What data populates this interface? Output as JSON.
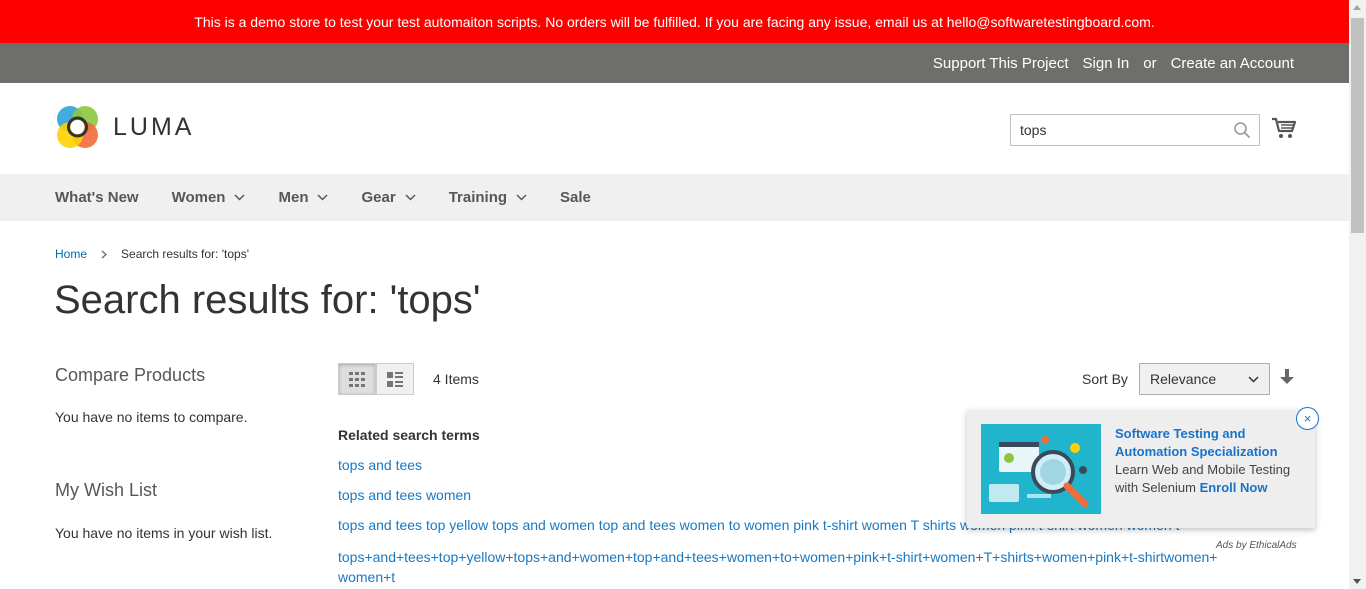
{
  "demo_notice": "This is a demo store to test your test automaiton scripts. No orders will be fulfilled. If you are facing any issue, email us at hello@softwaretestingboard.com.",
  "header": {
    "support": "Support This Project",
    "sign_in": "Sign In",
    "or": "or",
    "create_account": "Create an Account"
  },
  "logo": {
    "text": "LUMA"
  },
  "search": {
    "value": "tops"
  },
  "nav": [
    "What's New",
    "Women",
    "Men",
    "Gear",
    "Training",
    "Sale"
  ],
  "breadcrumb": {
    "home": "Home",
    "current": "Search results for: 'tops'"
  },
  "page_title": "Search results for: 'tops'",
  "sidebar": {
    "compare_title": "Compare Products",
    "compare_text": "You have no items to compare.",
    "wishlist_title": "My Wish List",
    "wishlist_text": "You have no items in your wish list."
  },
  "toolbar": {
    "item_count": "4 Items",
    "sort_label": "Sort By",
    "sort_value": "Relevance"
  },
  "related": {
    "title": "Related search terms",
    "terms": [
      "tops and tees",
      "tops and tees women",
      "tops and tees top yellow tops and women top and tees women to women pink t-shirt women T shirts women pink t-shirt women women t",
      "tops+and+tees+top+yellow+tops+and+women+top+and+tees+women+to+women+pink+t-shirt+women+T+shirts+women+pink+t-shirtwomen+women+t"
    ]
  },
  "ad": {
    "title": "Software Testing and Automation Specialization",
    "body": "Learn Web and Mobile Testing with Selenium",
    "cta": "Enroll Now",
    "close": "×",
    "by": "Ads by EthicalAds"
  },
  "colors": {
    "demo_bar": "#ff0000",
    "header_bar": "#6e6e6b",
    "nav_bg": "#f0f0f0",
    "link": "#1979c3",
    "ad_link": "#1a73c8"
  }
}
